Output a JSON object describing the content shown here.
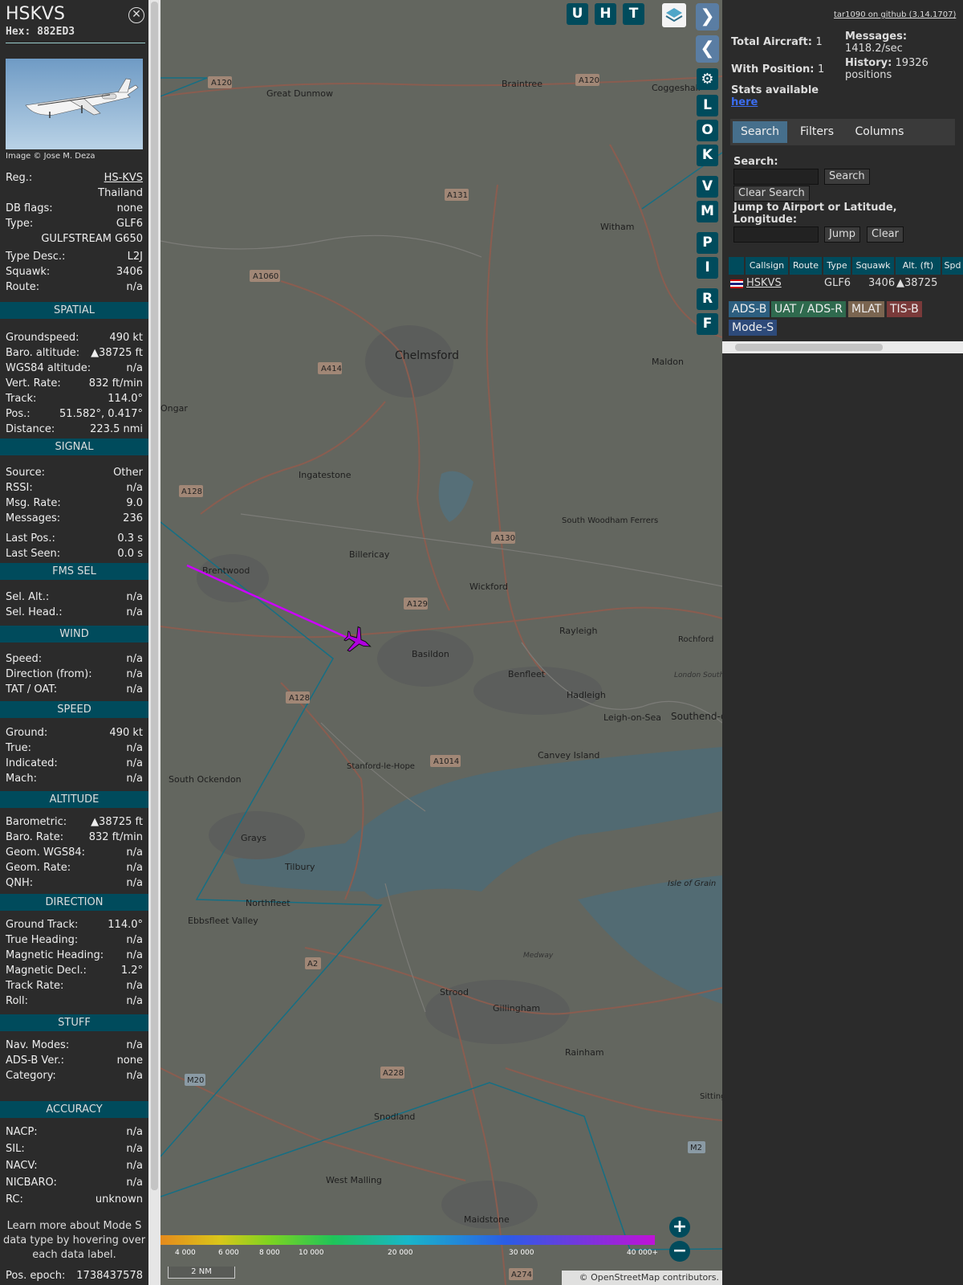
{
  "aircraft": {
    "callsign": "HSKVS",
    "hex_label": "Hex:",
    "hex": "882ED3",
    "image_credit": "Image © Jose M. Deza",
    "info": [
      {
        "label": "Reg.:",
        "value": "HS-KVS"
      },
      {
        "label": "",
        "value": "Thailand"
      },
      {
        "label": "DB flags:",
        "value": "none"
      },
      {
        "label": "Type:",
        "value": "GLF6"
      },
      {
        "label": "",
        "value": "GULFSTREAM G650"
      },
      {
        "label": "Type Desc.:",
        "value": "L2J"
      },
      {
        "label": "Squawk:",
        "value": "3406"
      },
      {
        "label": "Route:",
        "value": "n/a"
      }
    ],
    "sections": [
      {
        "title": "SPATIAL",
        "rows": [
          {
            "label": "Groundspeed:",
            "value": "490 kt"
          },
          {
            "label": "Baro. altitude:",
            "value": "▲38725 ft"
          },
          {
            "label": "WGS84 altitude:",
            "value": "n/a"
          },
          {
            "label": "Vert. Rate:",
            "value": "832 ft/min"
          },
          {
            "label": "Track:",
            "value": "114.0°"
          },
          {
            "label": "Pos.:",
            "value": "51.582°, 0.417°"
          },
          {
            "label": "Distance:",
            "value": "223.5 nmi"
          }
        ]
      },
      {
        "title": "SIGNAL",
        "rows": [
          {
            "label": "Source:",
            "value": "Other"
          },
          {
            "label": "RSSI:",
            "value": "n/a"
          },
          {
            "label": "Msg. Rate:",
            "value": "9.0"
          },
          {
            "label": "Messages:",
            "value": "236"
          },
          {
            "label": "Last Pos.:",
            "value": "0.3 s"
          },
          {
            "label": "Last Seen:",
            "value": "0.0 s"
          }
        ]
      },
      {
        "title": "FMS SEL",
        "rows": [
          {
            "label": "Sel. Alt.:",
            "value": "n/a"
          },
          {
            "label": "Sel. Head.:",
            "value": "n/a"
          }
        ]
      },
      {
        "title": "WIND",
        "rows": [
          {
            "label": "Speed:",
            "value": "n/a"
          },
          {
            "label": "Direction (from):",
            "value": "n/a"
          },
          {
            "label": "TAT / OAT:",
            "value": "n/a"
          }
        ]
      },
      {
        "title": "SPEED",
        "rows": [
          {
            "label": "Ground:",
            "value": "490 kt"
          },
          {
            "label": "True:",
            "value": "n/a"
          },
          {
            "label": "Indicated:",
            "value": "n/a"
          },
          {
            "label": "Mach:",
            "value": "n/a"
          }
        ]
      },
      {
        "title": "ALTITUDE",
        "rows": [
          {
            "label": "Barometric:",
            "value": "▲38725 ft"
          },
          {
            "label": "Baro. Rate:",
            "value": "832 ft/min"
          },
          {
            "label": "Geom. WGS84:",
            "value": "n/a"
          },
          {
            "label": "Geom. Rate:",
            "value": "n/a"
          },
          {
            "label": "QNH:",
            "value": "n/a"
          }
        ]
      },
      {
        "title": "DIRECTION",
        "rows": [
          {
            "label": "Ground Track:",
            "value": "114.0°"
          },
          {
            "label": "True Heading:",
            "value": "n/a"
          },
          {
            "label": "Magnetic Heading:",
            "value": "n/a"
          },
          {
            "label": "Magnetic Decl.:",
            "value": "1.2°"
          },
          {
            "label": "Track Rate:",
            "value": "n/a"
          },
          {
            "label": "Roll:",
            "value": "n/a"
          }
        ]
      },
      {
        "title": "STUFF",
        "rows": [
          {
            "label": "Nav. Modes:",
            "value": "n/a"
          },
          {
            "label": "ADS-B Ver.:",
            "value": "none"
          },
          {
            "label": "Category:",
            "value": "n/a"
          }
        ]
      },
      {
        "title": "ACCURACY",
        "rows": [
          {
            "label": "NACP:",
            "value": "n/a"
          },
          {
            "label": "SIL:",
            "value": "n/a"
          },
          {
            "label": "NACV:",
            "value": "n/a"
          },
          {
            "label": "NICBARO:",
            "value": "n/a"
          },
          {
            "label": "RC:",
            "value": "unknown"
          }
        ]
      }
    ],
    "learn_more": "Learn more about Mode S data type by hovering over each data label.",
    "pos_epoch_label": "Pos. epoch:",
    "pos_epoch": "1738437578"
  },
  "map": {
    "top_buttons": [
      "U",
      "H",
      "T"
    ],
    "side_buttons": [
      "L",
      "O",
      "K",
      "V",
      "M",
      "P",
      "I",
      "R",
      "F"
    ],
    "places": [
      "Great Dunmow",
      "Braintree",
      "Coggeshall",
      "Witham",
      "Chelmsford",
      "Maldon",
      "Ingatestone",
      "Ongar",
      "South Woodham Ferrers",
      "Billericay",
      "Brentwood",
      "Wickford",
      "Rayleigh",
      "Rochford",
      "Basildon",
      "Benfleet",
      "Hadleigh",
      "Leigh-on-Sea",
      "Southend-on-Sea",
      "Canvey Island",
      "Stanford-le-Hope",
      "South Ockendon",
      "Grays",
      "Tilbury",
      "Northfleet",
      "Ebbsfleet Valley",
      "Isle of Grain",
      "Strood",
      "Gillingham",
      "Rainham",
      "Snodland",
      "West Malling",
      "Maidstone",
      "London Southend Airport",
      "Medway",
      "Sittingbourne"
    ],
    "roads": [
      "A120",
      "A120",
      "A131",
      "A1060",
      "A414",
      "A128",
      "A130",
      "A129",
      "A128",
      "A1014",
      "A2",
      "A228",
      "M20",
      "M2",
      "A274"
    ],
    "altitude_scale": [
      "4 000",
      "6 000",
      "8 000",
      "10 000",
      "20 000",
      "30 000",
      "40 000+"
    ],
    "scale_bar": "2 NM",
    "attribution": "© OpenStreetMap contributors."
  },
  "right": {
    "github_link": "tar1090 on github (3.14.1707)",
    "total_label": "Total Aircraft:",
    "total": "1",
    "with_pos_label": "With Position:",
    "with_pos": "1",
    "messages_label": "Messages:",
    "messages_rate": "1418.2/sec",
    "history_label": "History:",
    "history": "19326 positions",
    "stats_label": "Stats available",
    "stats_link": "here",
    "tabs": [
      "Search",
      "Filters",
      "Columns"
    ],
    "search_label": "Search:",
    "search_btn": "Search",
    "clear_search_btn": "Clear Search",
    "jump_label": "Jump to Airport or Latitude, Longitude:",
    "jump_btn": "Jump",
    "clear_btn": "Clear",
    "columns": [
      "Callsign",
      "Route",
      "Type",
      "Squawk",
      "Alt. (ft)",
      "Spd"
    ],
    "rows": [
      {
        "callsign": "HSKVS",
        "route": "",
        "type": "GLF6",
        "squawk": "3406",
        "alt": "▲38725"
      }
    ],
    "legend": [
      "ADS-B",
      "UAT / ADS-R",
      "MLAT",
      "TIS-B",
      "Mode-S"
    ]
  },
  "colors": {
    "accent": "#004b5c",
    "track": "#cc00ff",
    "aircraft": "#b000e0",
    "active_tab": "#466f8c"
  }
}
